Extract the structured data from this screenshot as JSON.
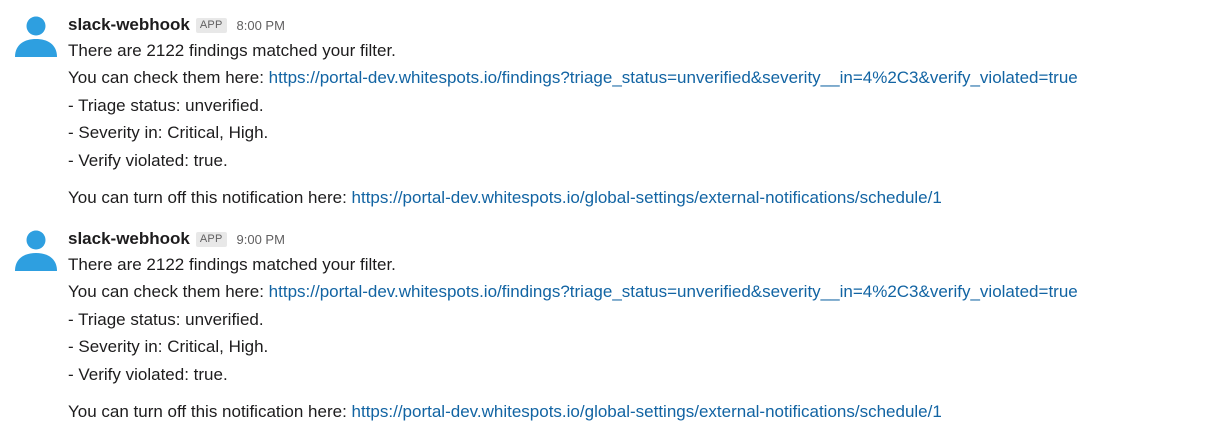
{
  "messages": [
    {
      "sender": "slack-webhook",
      "badge": "APP",
      "time": "8:00 PM",
      "summary": "There are 2122 findings matched your filter.",
      "check_prefix": "You can check them here: ",
      "check_url": "https://portal-dev.whitespots.io/findings?triage_status=unverified&severity__in=4%2C3&verify_violated=true",
      "filters": [
        "- Triage status: unverified.",
        "- Severity in: Critical, High.",
        "- Verify violated: true."
      ],
      "off_prefix": "You can turn off this notification here: ",
      "off_url": "https://portal-dev.whitespots.io/global-settings/external-notifications/schedule/1"
    },
    {
      "sender": "slack-webhook",
      "badge": "APP",
      "time": "9:00 PM",
      "summary": "There are 2122 findings matched your filter.",
      "check_prefix": "You can check them here: ",
      "check_url": "https://portal-dev.whitespots.io/findings?triage_status=unverified&severity__in=4%2C3&verify_violated=true",
      "filters": [
        "- Triage status: unverified.",
        "- Severity in: Critical, High.",
        "- Verify violated: true."
      ],
      "off_prefix": "You can turn off this notification here: ",
      "off_url": "https://portal-dev.whitespots.io/global-settings/external-notifications/schedule/1"
    }
  ],
  "colors": {
    "avatar": "#2e9fe0",
    "link": "#1264a3",
    "text": "#1d1c1d",
    "muted": "#616061"
  },
  "icons": {
    "avatar": "user-avatar-icon"
  }
}
